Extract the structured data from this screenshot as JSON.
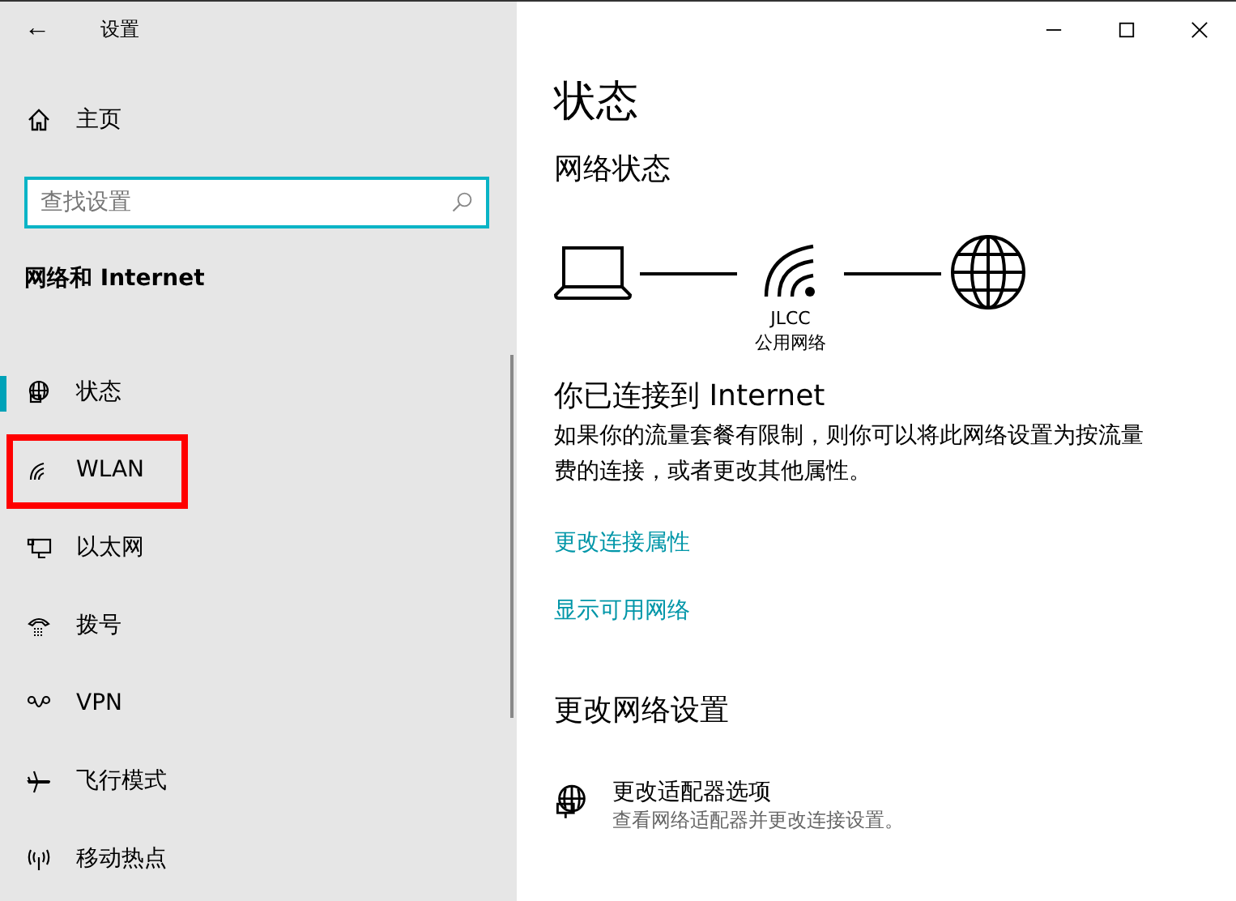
{
  "window": {
    "title": "设置",
    "back": "←"
  },
  "sidebar": {
    "home": "主页",
    "search": {
      "placeholder": "查找设置"
    },
    "category": "网络和 Internet",
    "items": [
      {
        "label": "状态",
        "kind": "status",
        "selected": true,
        "highlighted": false
      },
      {
        "label": "WLAN",
        "kind": "wifi",
        "selected": false,
        "highlighted": true
      },
      {
        "label": "以太网",
        "kind": "ethernet",
        "selected": false,
        "highlighted": false
      },
      {
        "label": "拨号",
        "kind": "dialup",
        "selected": false,
        "highlighted": false
      },
      {
        "label": "VPN",
        "kind": "vpn",
        "selected": false,
        "highlighted": false
      },
      {
        "label": "飞行模式",
        "kind": "airplane",
        "selected": false,
        "highlighted": false
      },
      {
        "label": "移动热点",
        "kind": "hotspot",
        "selected": false,
        "highlighted": false
      }
    ]
  },
  "content": {
    "title": "状态",
    "section": "网络状态",
    "network": {
      "name": "JLCC",
      "type": "公用网络"
    },
    "connected": "你已连接到 Internet",
    "description": [
      "如果你的流量套餐有限制，则你可以将此网络设置为按流量",
      "费的连接，或者更改其他属性。"
    ],
    "links": [
      "更改连接属性",
      "显示可用网络"
    ],
    "section2": "更改网络设置",
    "options": [
      {
        "title": "更改适配器选项",
        "subtitle": "查看网络适配器并更改连接设置。"
      }
    ]
  }
}
